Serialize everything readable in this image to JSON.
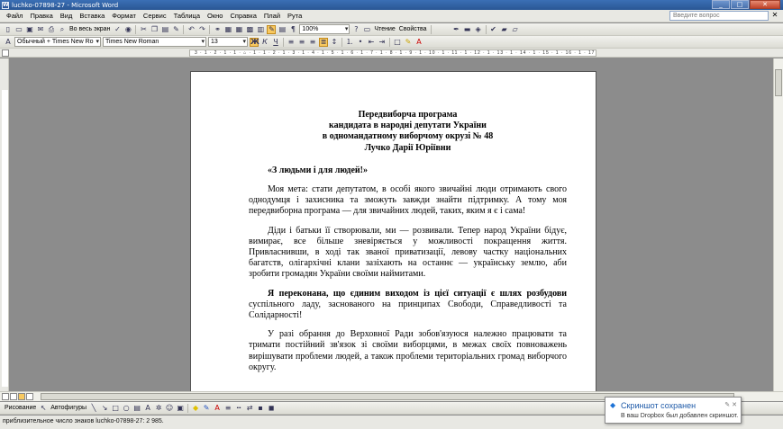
{
  "window": {
    "title": "luchko-07898-27 - Microsoft Word"
  },
  "menu": [
    "Файл",
    "Правка",
    "Вид",
    "Вставка",
    "Формат",
    "Сервис",
    "Таблица",
    "Окно",
    "Справка",
    "Плай",
    "Рута"
  ],
  "help": {
    "placeholder": "Введите вопрос"
  },
  "toolbar1": {
    "fit_label": "Во весь экран",
    "zoom": "100%",
    "read_label": "Чтение",
    "rev_label": "Свойства"
  },
  "toolbar2": {
    "style": "Обычный + Times New Ro",
    "font": "Times New Roman",
    "size": "13"
  },
  "ruler": {
    "numbers": "3 · 1 · 2 · 1 · 1 · ⌂ · 1 · 1 · 2 · 1 · 3 · 1 · 4 · 1 · 5 · 1 · 6 · 1 · 7 · 1 · 8 · 1 · 9 · 1 · 10 · 1 · 11 · 1 · 12 · 1 · 13 · 1 · 14 · 1 · 15 · 1 · 16 · 1 · 17"
  },
  "document": {
    "heading": [
      "Передвиборча програма",
      "кандидата в народні депутати України",
      "в одномандатному виборчому окрузі № 48",
      "Лучко Дарії Юріївни"
    ],
    "slogan": "«З людьми і для людей!»",
    "p1": "Моя мета: стати депутатом, в особі якого звичайні люди отримають свого однодумця і захисника та зможуть завжди знайти підтримку. А тому моя передвиборна програма — для звичайних людей, таких, яким я є і сама!",
    "p2": "Діди і батьки її створювали, ми — розвивали. Тепер народ України бідує, вимирає, все більше зневіряється у можливості покращення життя. Привласнивши, в ході так званої приватизації, левову частку національних багатств, олігархічні клани зазіхають на останнє — українську землю, аби зробити громадян України своїми наймитами.",
    "p3_bold": "Я переконана, що єдиним виходом із цієї ситуації є шлях розбудови",
    "p3_rest": " суспільного ладу, заснованого на принципах Свободи, Справедливості та Солідарності!",
    "p4": "У разі обрання до Верховної Ради зобов'язуюся належно працювати та тримати постійний зв'язок зі своїми виборцями, в межах своїх повноважень вирішувати проблеми людей, а також проблеми територіальних громад виборчого округу."
  },
  "drawing": {
    "draw_label": "Рисование",
    "autoshapes_label": "Автофигуры"
  },
  "status": {
    "text": "приблизительное число знаков luchko-07898-27: 2 985."
  },
  "toast": {
    "title": "Скриншот сохранен",
    "body": "В ваш Dropbox был добавлен скриншот."
  }
}
